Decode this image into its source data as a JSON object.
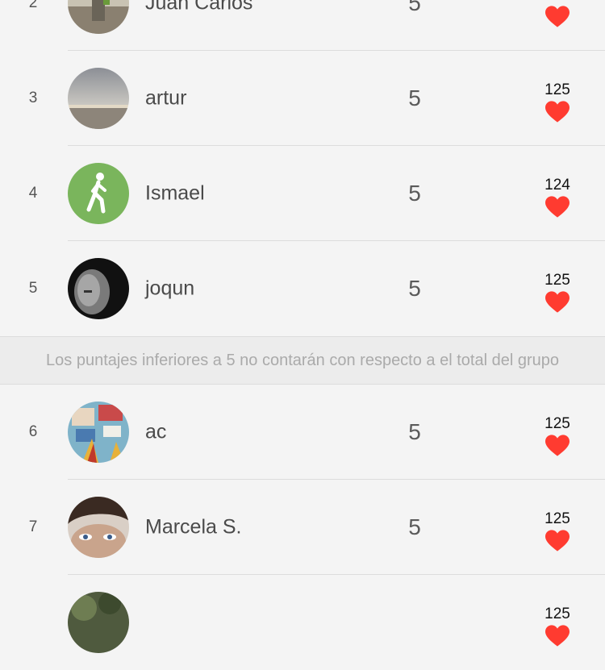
{
  "colors": {
    "heart": "#ff3b30",
    "background": "#f4f4f4",
    "notice_bg": "#ececec"
  },
  "leaderboard": {
    "rows_top": [
      {
        "rank": "2",
        "name": "Juan Carlos",
        "score": "5",
        "likes": "",
        "avatar": "photo-landscape-person"
      },
      {
        "rank": "3",
        "name": "artur",
        "score": "5",
        "likes": "125",
        "avatar": "photo-cloudy-sky"
      },
      {
        "rank": "4",
        "name": "Ismael",
        "score": "5",
        "likes": "124",
        "avatar": "walking-person-icon"
      },
      {
        "rank": "5",
        "name": "joqun",
        "score": "5",
        "likes": "125",
        "avatar": "photo-bw-portrait"
      }
    ],
    "notice": "Los puntajes inferiores a 5 no contarán con respecto a el total del grupo",
    "rows_bottom": [
      {
        "rank": "6",
        "name": "ac",
        "score": "5",
        "likes": "125",
        "avatar": "photo-colorful-collage"
      },
      {
        "rank": "7",
        "name": "Marcela S.",
        "score": "5",
        "likes": "125",
        "avatar": "photo-face-closeup"
      },
      {
        "rank": "",
        "name": "",
        "score": "",
        "likes": "125",
        "avatar": "photo-trees"
      }
    ]
  }
}
